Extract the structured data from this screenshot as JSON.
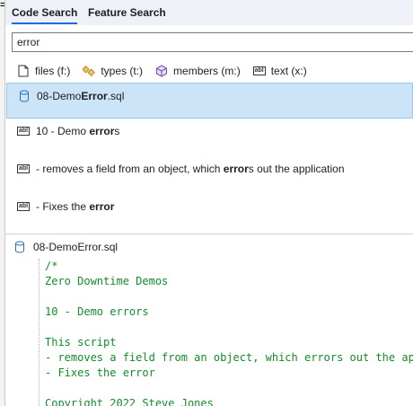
{
  "tabs": [
    {
      "label": "Code Search",
      "active": true
    },
    {
      "label": "Feature Search",
      "active": false
    }
  ],
  "search": {
    "value": "error",
    "placeholder": ""
  },
  "filters": [
    {
      "label": "files (f:)",
      "icon": "file-icon"
    },
    {
      "label": "types (t:)",
      "icon": "types-icon"
    },
    {
      "label": "members (m:)",
      "icon": "members-icon"
    },
    {
      "label": "text (x:)",
      "icon": "text-icon"
    }
  ],
  "results": [
    {
      "icon": "database-file-icon",
      "before": "08-Demo",
      "match": "Error",
      "after": ".sql",
      "selected": true
    },
    {
      "icon": "text-icon",
      "before": "10 - Demo ",
      "match": "error",
      "after": "s",
      "selected": false
    },
    {
      "icon": "text-icon",
      "before": "- removes a field from an object, which ",
      "match": "error",
      "after": "s out the application",
      "selected": false
    },
    {
      "icon": "text-icon",
      "before": "- Fixes the ",
      "match": "error",
      "after": "",
      "selected": false
    }
  ],
  "preview": {
    "file_name": "08-DemoError.sql",
    "code_lines": [
      "/*",
      "Zero Downtime Demos",
      "",
      "10 - Demo errors",
      "",
      "This script",
      "- removes a field from an object, which errors out the application",
      "- Fixes the error",
      "",
      "Copyright 2022 Steve Jones"
    ]
  },
  "colors": {
    "accent": "#1e6ed8",
    "selected_bg": "#cce4f7",
    "code_green": "#128c2b"
  }
}
